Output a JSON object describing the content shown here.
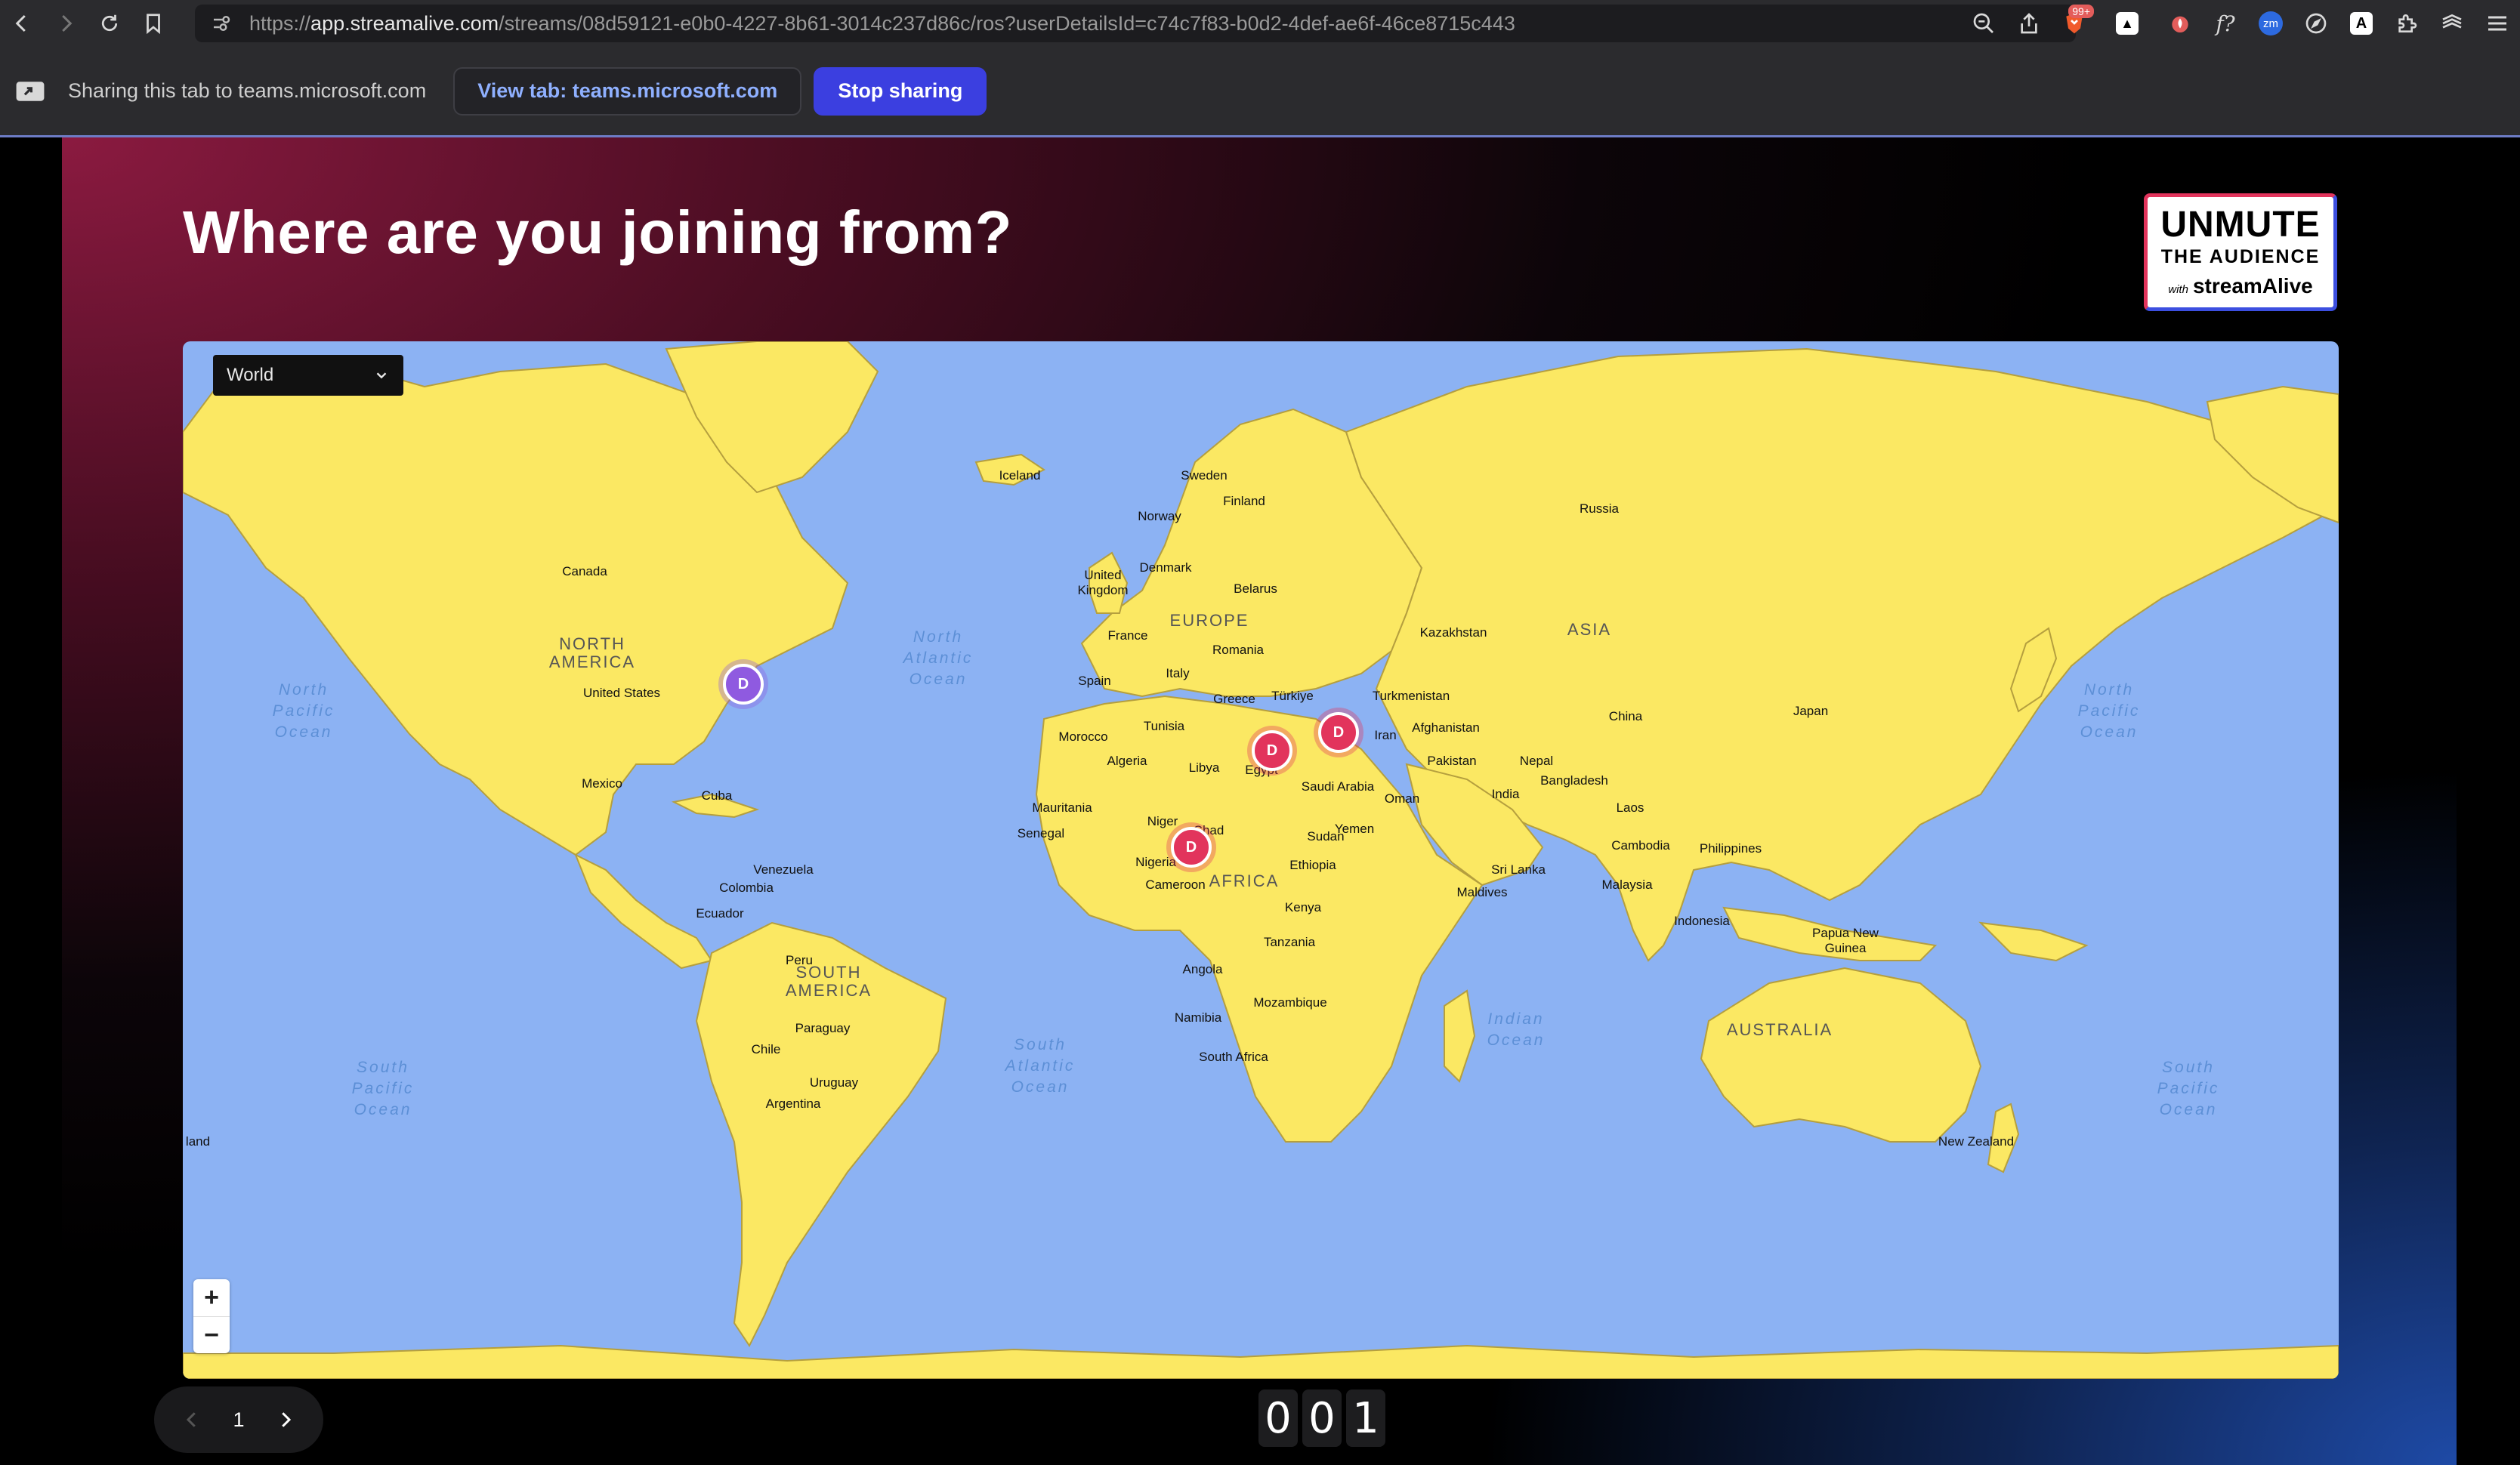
{
  "browser": {
    "url_prefix": "https://",
    "url_host": "app.streamalive.com",
    "url_path": "/streams/08d59121-e0b0-4227-8b61-3014c237d86c/ros?userDetailsId=c74c7f83-b0d2-4def-ae6f-46ce8715c443",
    "brave_badge": "99+",
    "extensions": [
      "zoom-out-icon",
      "share-icon",
      "brave-shield-icon",
      "ext-a-icon",
      "ext-flame-icon",
      "ext-fx-icon",
      "ext-zm-icon",
      "ext-compass-icon",
      "ext-a2-icon",
      "puzzle-icon",
      "layers-icon",
      "menu-icon"
    ],
    "ext_labels": {
      "fx": "f?",
      "zm": "zm",
      "a": "A"
    }
  },
  "sharing": {
    "status": "Sharing this tab to teams.microsoft.com",
    "view_tab": "View tab: teams.microsoft.com",
    "stop": "Stop sharing"
  },
  "slide": {
    "title": "Where are you joining from?",
    "logo": {
      "line1": "UNMUTE",
      "line2": "THE AUDIENCE",
      "with": "with",
      "brand": "streamAlive"
    }
  },
  "map": {
    "region_selected": "World",
    "zoom_in": "+",
    "zoom_out": "−",
    "colors": {
      "ocean": "#8cb2f3",
      "land": "#fbe863",
      "marker_red": "#e2345c",
      "marker_purple": "#8f5ae0"
    },
    "marker_label": "D",
    "countries": [
      "Iceland",
      "Sweden",
      "Finland",
      "Norway",
      "Russia",
      "Denmark",
      "United Kingdom",
      "Belarus",
      "Canada",
      "France",
      "Romania",
      "Kazakhstan",
      "Italy",
      "Spain",
      "Greece",
      "Türkiye",
      "Turkmenistan",
      "United States",
      "Tunisia",
      "Iran",
      "Afghanistan",
      "China",
      "Japan",
      "Morocco",
      "Algeria",
      "Libya",
      "Egypt",
      "Pakistan",
      "Nepal",
      "Bangladesh",
      "Mexico",
      "Cuba",
      "Saudi Arabia",
      "Oman",
      "India",
      "Mauritania",
      "Niger",
      "Chad",
      "Senegal",
      "Sudan",
      "Yemen",
      "Laos",
      "Cambodia",
      "Philippines",
      "Venezuela",
      "Nigeria",
      "Cameroon",
      "Ethiopia",
      "Sri Lanka",
      "Colombia",
      "Maldives",
      "Malaysia",
      "Ecuador",
      "Kenya",
      "Indonesia",
      "Tanzania",
      "Papua New Guinea",
      "Peru",
      "Angola",
      "Mozambique",
      "Paraguay",
      "Namibia",
      "Chile",
      "South Africa",
      "Uruguay",
      "Argentina",
      "New Zealand",
      "land"
    ],
    "regions": [
      "NORTH AMERICA",
      "EUROPE",
      "ASIA",
      "AFRICA",
      "SOUTH AMERICA",
      "AUSTRALIA"
    ],
    "oceans": [
      "North Atlantic Ocean",
      "North Pacific Ocean",
      "North Pacific Ocean",
      "South Atlantic Ocean",
      "Indian Ocean",
      "South Pacific Ocean",
      "South Pacific Ocean"
    ]
  },
  "pager": {
    "page": "1"
  },
  "counter": {
    "digits": [
      "0",
      "0",
      "1"
    ]
  }
}
